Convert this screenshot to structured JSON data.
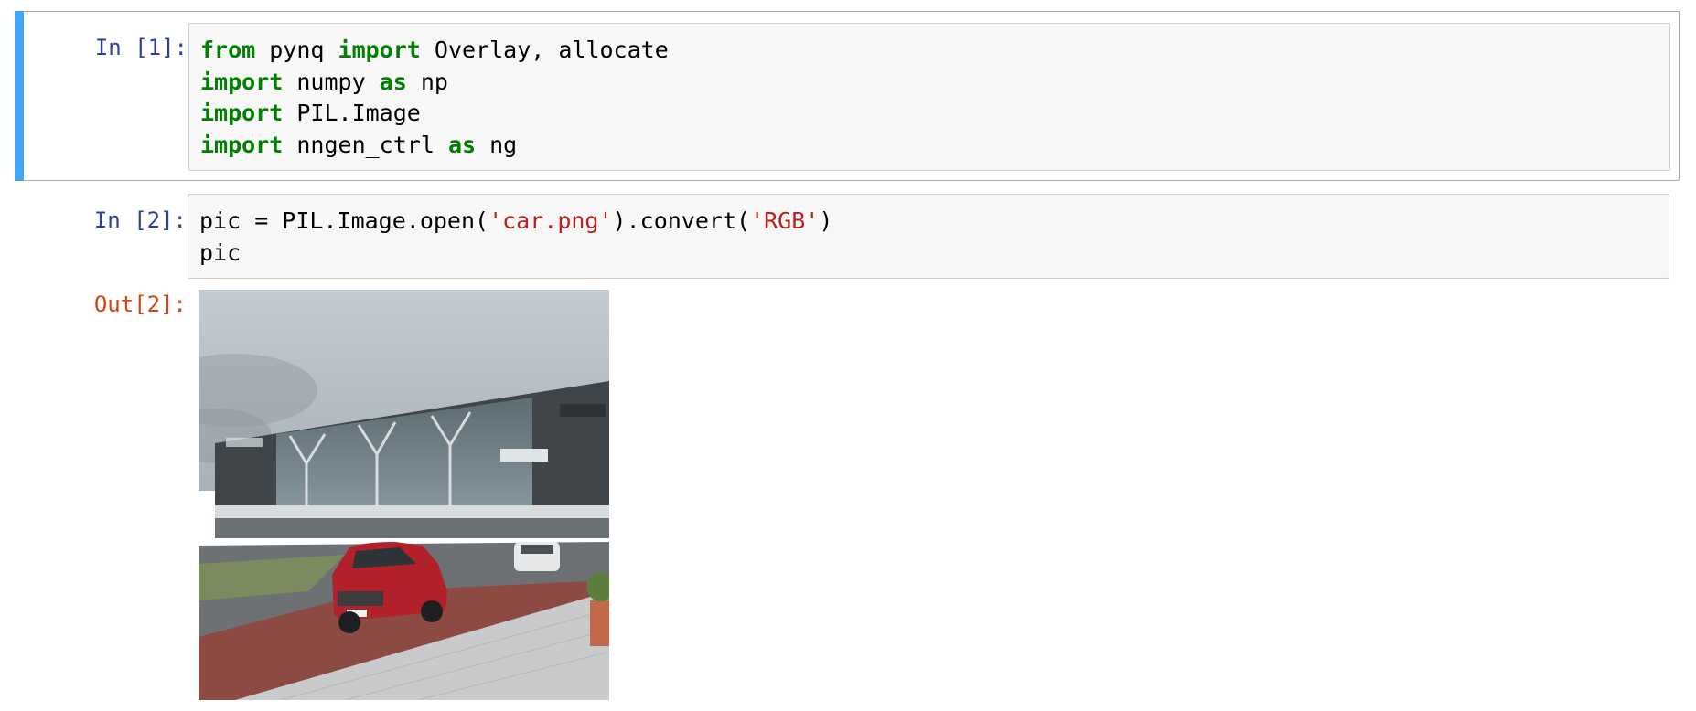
{
  "notebook": {
    "cells": [
      {
        "prompt": "In [1]:",
        "lines": [
          [
            {
              "t": "from",
              "k": "kw"
            },
            {
              "t": " pynq "
            },
            {
              "t": "import",
              "k": "kw"
            },
            {
              "t": " Overlay, allocate"
            }
          ],
          [
            {
              "t": "import",
              "k": "kw"
            },
            {
              "t": " numpy "
            },
            {
              "t": "as",
              "k": "kw"
            },
            {
              "t": " np"
            }
          ],
          [
            {
              "t": "import",
              "k": "kw"
            },
            {
              "t": " PIL.Image"
            }
          ],
          [
            {
              "t": "import",
              "k": "kw"
            },
            {
              "t": " nngen_ctrl "
            },
            {
              "t": "as",
              "k": "kw"
            },
            {
              "t": " ng"
            }
          ]
        ]
      },
      {
        "prompt": "In [2]:",
        "lines": [
          [
            {
              "t": "pic = PIL.Image.open("
            },
            {
              "t": "'car.png'",
              "k": "str"
            },
            {
              "t": ").convert("
            },
            {
              "t": "'RGB'",
              "k": "str"
            },
            {
              "t": ")"
            }
          ],
          [
            {
              "t": "pic"
            }
          ]
        ],
        "output_prompt": "Out[2]:",
        "output_image": "photo of a red SUV parked in front of a modern glass station building on an overcast day"
      }
    ],
    "colors": {
      "keyword": "#008000",
      "string": "#ba2121",
      "in_prompt": "#303f9f",
      "out_prompt": "#d84315",
      "selected_bar": "#42a5f5"
    }
  }
}
